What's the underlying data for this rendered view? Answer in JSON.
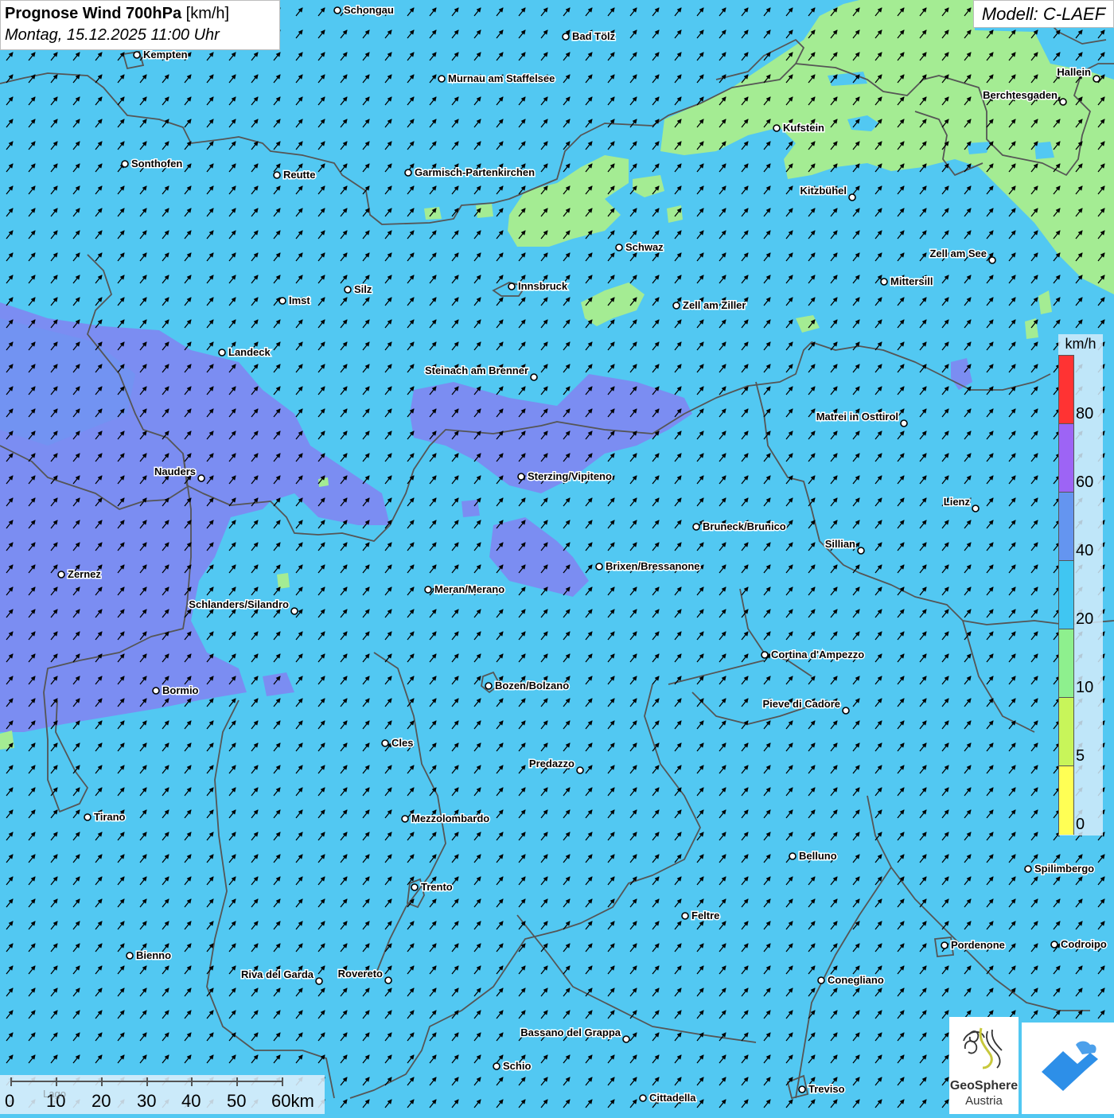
{
  "header": {
    "title_bold": "Prognose Wind 700hPa",
    "title_unit": "[km/h]",
    "subtitle": "Montag, 15.12.2025 11:00 Uhr",
    "model": "Modell: C-LAEF"
  },
  "legend": {
    "unit": "km/h",
    "ticks": [
      "80",
      "60",
      "40",
      "20",
      "10",
      "5",
      "0"
    ],
    "colors": [
      "#ff3333",
      "#9d64f5",
      "#6495f0",
      "#40c6f2",
      "#8ef08e",
      "#c8f55a",
      "#ffff55"
    ]
  },
  "scale_bar": {
    "labels": [
      "0",
      "10",
      "20",
      "30",
      "40",
      "50",
      "60km"
    ],
    "faint_label": "Lago"
  },
  "logos": {
    "geosphere_name": "GeoSphere",
    "geosphere_sub": "Austria"
  },
  "colors": {
    "wind_0_5": "#ffff55",
    "wind_5_10": "#c8f55a",
    "wind_10_20": "#a4ec93",
    "wind_20_40": "#52c8f2",
    "wind_40_60": "#7b8df2",
    "wind_60_80": "#9d64f5",
    "wind_80_plus": "#ff3333",
    "borders": "#555555",
    "logo_blue": "#2d8fe8"
  },
  "places": [
    "Schongau",
    "Bad Tölz",
    "Kempten",
    "Murnau am Staffelsee",
    "Hallein",
    "Berchtesgaden",
    "Kufstein",
    "Sonthofen",
    "Reutte",
    "Garmisch-Partenkirchen",
    "Kitzbühel",
    "Schwaz",
    "Zell am See",
    "Mittersill",
    "Imst",
    "Silz",
    "Innsbruck",
    "Zell am Ziller",
    "Landeck",
    "Steinach am Brenner",
    "Matrei in Osttirol",
    "Nauders",
    "Sterzing/Vipiteno",
    "Lienz",
    "Bruneck/Brunico",
    "Sillian",
    "Zernez",
    "Brixen/Bressanone",
    "Meran/Merano",
    "Schlanders/Silandro",
    "Cortina d'Ampezzo",
    "Bozen/Bolzano",
    "Bormio",
    "Pieve di Cadore",
    "Cles",
    "Predazzo",
    "Tirano",
    "Mezzolombardo",
    "Belluno",
    "Spilimbergo",
    "Trento",
    "Feltre",
    "Pordenone",
    "Codroipo",
    "Bienno",
    "Riva del Garda",
    "Rovereto",
    "Conegliano",
    "Bassano del Grappa",
    "Schio",
    "Treviso",
    "Cittadella"
  ]
}
